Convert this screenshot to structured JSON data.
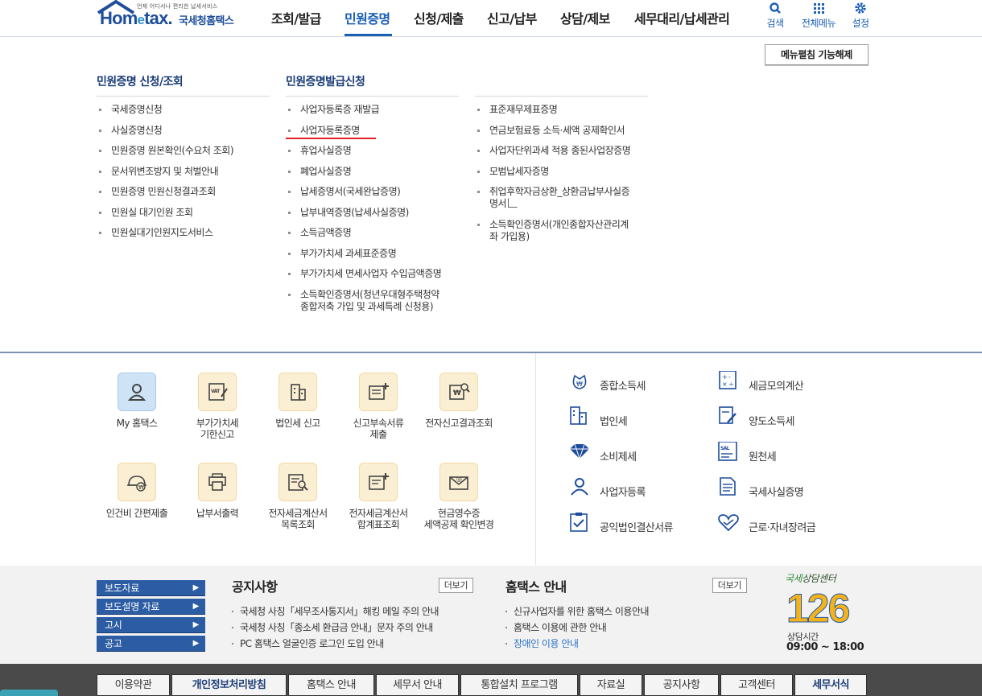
{
  "header": {
    "logo_small": "언제 어디서나 편리한 납세서비스",
    "logo_brand_1": "Hom",
    "logo_brand_e": "e",
    "logo_brand_2": "tax.",
    "logo_kr": "국세청홈택스",
    "nav": [
      "조회/발급",
      "민원증명",
      "신청/제출",
      "신고/납부",
      "상담/제보",
      "세무대리/납세관리"
    ],
    "active_nav": "민원증명",
    "util": [
      "검색",
      "전체메뉴",
      "설정"
    ]
  },
  "mega_menu": {
    "fix_button": "메뉴펼침 기능해제",
    "col1_title": "민원증명 신청/조회",
    "col1": [
      "국세증명신청",
      "사실증명신청",
      "민원증명 원본확인(수요처 조회)",
      "문서위변조방지 및 처벌안내",
      "민원증명 민원신청결과조회",
      "민원실 대기인원 조회",
      "민원실대기인원지도서비스"
    ],
    "col2_title": "민원증명발급신청",
    "col2": [
      "사업자등록증 재발급",
      "사업자등록증명",
      "휴업사실증명",
      "폐업사실증명",
      "납세증명서(국세완납증명)",
      "납부내역증명(납세사실증명)",
      "소득금액증명",
      "부가가치세 과세표준증명",
      "부가가치세 면세사업자 수입금액증명",
      "소득확인증명서(청년우대형주택청약",
      "종합저축 가입 및 과세특례 신청용)"
    ],
    "col3": [
      "표준재무제표증명",
      "연금보험료등 소득·세액 공제확인서",
      "사업자단위과세 적용 종된사업장증명",
      "모범납세자증명",
      "취업후학자금상환_상환금납부사실증",
      "명서",
      "소득확인증명서(개인종합자산관리계",
      "좌 가입용)"
    ]
  },
  "quick_icons": [
    "My 홈택스",
    "부가가치세",
    "기한신고",
    "법인세 신고",
    "신고부속서류",
    "제출",
    "전자신고결과조회",
    "인건비 간편제출",
    "납부서출력",
    "전자세금계산서",
    "목록조회",
    "전자세금계산서",
    "합계표조회",
    "현금영수증",
    "세액공제 확인변경"
  ],
  "right_icons": [
    "종합소득세",
    "세금모의계산",
    "법인세",
    "양도소득세",
    "소비제세",
    "원천세",
    "사업자등록",
    "국세사실증명",
    "공익법인결산서류",
    "근로·자녀장려금"
  ],
  "notice": {
    "categories": [
      "보도자료",
      "보도설명 자료",
      "고시",
      "공고"
    ],
    "notice_title": "공지사항",
    "more": "더보기",
    "notice_items": [
      "국세청 사칭「세무조사통지서」해킹 메일 주의 안내",
      "국세청 사칭「종소세 환급금 안내」문자 주의 안내",
      "PC 홈택스 얼굴인증 로그인 도입 안내"
    ],
    "hometax_title": "홈택스 안내",
    "hometax_items": [
      "신규사업자를 위한 홈택스 이용안내",
      "홈택스 이용에 관한 안내",
      "장애인 이용 안내"
    ]
  },
  "center": {
    "label_1": "국세",
    "label_2": "상담센터",
    "number": "126",
    "hours_label": "상담시간",
    "hours": "09:00 ~ 18:00"
  },
  "footer": [
    "이용약관",
    "개인정보처리방침",
    "홈택스 안내",
    "세무서 안내",
    "통합설치 프로그램",
    "자료실",
    "공지사항",
    "고객센터",
    "세무서식"
  ],
  "colors": {
    "brand": "#1d4d9b",
    "accent": "#1b5fb4",
    "category": "#2c5ca3",
    "highlight": "#e02020"
  }
}
